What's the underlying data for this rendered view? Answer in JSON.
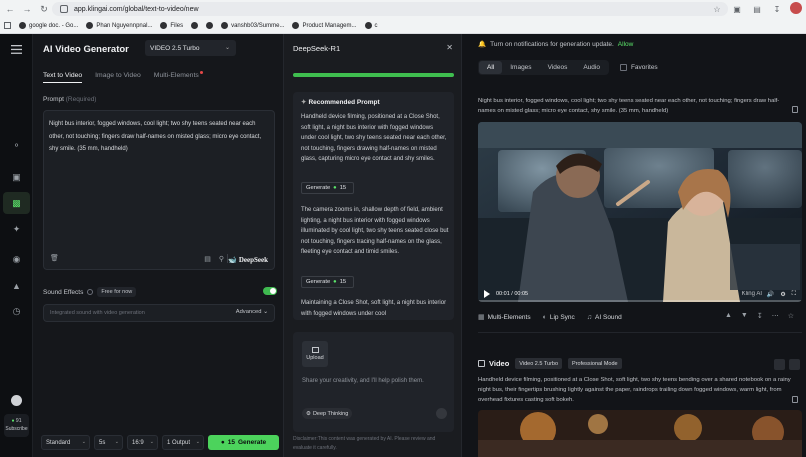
{
  "browser": {
    "url": "app.klingai.com/global/text-to-video/new",
    "bookmarks": [
      "google doc. - Go...",
      "Phan Nguyennpnal...",
      "Files",
      "vanshb03/Summe...",
      "Product Managem...",
      "c"
    ]
  },
  "rail": {
    "credit_value": "91",
    "credit_label": "Subscribe"
  },
  "generator": {
    "title": "AI Video Generator",
    "model": "VIDEO 2.5 Turbo",
    "tabs": [
      "Text to Video",
      "Image to Video",
      "Multi-Elements"
    ],
    "prompt_label": "Prompt",
    "prompt_required": "(Required)",
    "prompt_text": "Night bus interior, fogged windows, cool light; two shy teens seated near each other, not touching; fingers draw half-names on misted glass; micro eye contact, shy smile. (35 mm, handheld)",
    "deepseek_label": "DeepSeek",
    "sound_effects_label": "Sound Effects",
    "free_badge": "Free for now",
    "sound_placeholder": "Integrated sound with video generation",
    "advanced_label": "Advanced",
    "mode": "Standard",
    "duration": "5s",
    "ratio": "16:9",
    "outputs": "1 Output",
    "cost": "15",
    "generate_label": "Generate"
  },
  "deepseek": {
    "title": "DeepSeek-R1",
    "recommended_label": "Recommended Prompt",
    "prompts": [
      "Handheld device filming, positioned at a Close Shot, soft light, a night bus interior with fogged windows under cool light, two shy teens seated near each other, not touching, fingers drawing half-names on misted glass, capturing micro eye contact and shy smiles.",
      "The camera zooms in, shallow depth of field, ambient lighting, a night bus interior with fogged windows illuminated by cool light, two shy teens seated close but not touching, fingers tracing half-names on the glass, fleeting eye contact and timid smiles.",
      "Maintaining a Close Shot, soft light, a night bus interior with fogged windows under cool"
    ],
    "generate_label": "Generate",
    "generate_cost": "15",
    "upload_label": "Upload",
    "input_placeholder": "Share your creativity, and I'll help polish them.",
    "deep_thinking_label": "Deep Thinking",
    "disclaimer": "Disclaimer:This content was generated by AI. Please review and evaluate it carefully."
  },
  "results": {
    "notification_text": "Turn on notifications for generation update.",
    "allow_label": "Allow",
    "filter_tabs": [
      "All",
      "Images",
      "Videos",
      "Audio"
    ],
    "favorites_label": "Favorites",
    "video1_prompt": "Night bus interior, fogged windows, cool light; two shy teens seated near each other, not touching; fingers draw half-names on misted glass; micro eye contact, shy smile. (35 mm, handheld)",
    "video1_time": "00:01 / 00:05",
    "watermark": "Kling AI",
    "actions": [
      "Multi-Elements",
      "Lip Sync",
      "AI Sound"
    ],
    "video2_title": "Video",
    "video2_badges": [
      "Video 2.5 Turbo",
      "Professional Mode"
    ],
    "video2_prompt": "Handheld device filming, positioned at a Close Shot, soft light, two shy teens bending over a shared notebook on a rainy night bus, their fingertips brushing lightly against the paper, raindrops trailing down fogged windows, warm light, from overhead fixtures casting soft bokeh."
  }
}
